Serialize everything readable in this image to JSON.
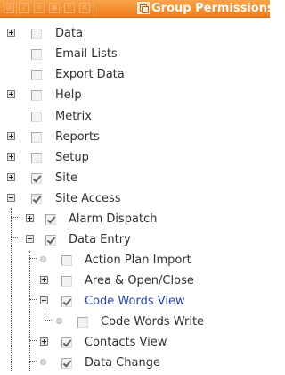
{
  "toolbar": {
    "title": "Group Permissions",
    "icons": [
      "list-icon",
      "edit-icon",
      "add-icon",
      "save-icon",
      "filter-icon",
      "delete-icon"
    ]
  },
  "tree": [
    {
      "label": "Data",
      "checked": false,
      "expander": "plus"
    },
    {
      "label": "Email Lists",
      "checked": false,
      "expander": "none"
    },
    {
      "label": "Export Data",
      "checked": false,
      "expander": "none"
    },
    {
      "label": "Help",
      "checked": false,
      "expander": "plus"
    },
    {
      "label": "Metrix",
      "checked": false,
      "expander": "none"
    },
    {
      "label": "Reports",
      "checked": false,
      "expander": "plus"
    },
    {
      "label": "Setup",
      "checked": false,
      "expander": "plus"
    },
    {
      "label": "Site",
      "checked": true,
      "expander": "plus"
    },
    {
      "label": "Site Access",
      "checked": true,
      "expander": "minus"
    },
    {
      "label": "Alarm Dispatch",
      "checked": true,
      "expander": "plus"
    },
    {
      "label": "Data Entry",
      "checked": true,
      "expander": "minus"
    },
    {
      "label": "Action Plan Import",
      "checked": false,
      "expander": "leaf"
    },
    {
      "label": "Area & Open/Close",
      "checked": false,
      "expander": "plus"
    },
    {
      "label": "Code Words View",
      "checked": true,
      "expander": "minus"
    },
    {
      "label": "Code Words Write",
      "checked": false,
      "expander": "leaf"
    },
    {
      "label": "Contacts View",
      "checked": true,
      "expander": "plus"
    },
    {
      "label": "Data Change",
      "checked": true,
      "expander": "leaf"
    }
  ]
}
